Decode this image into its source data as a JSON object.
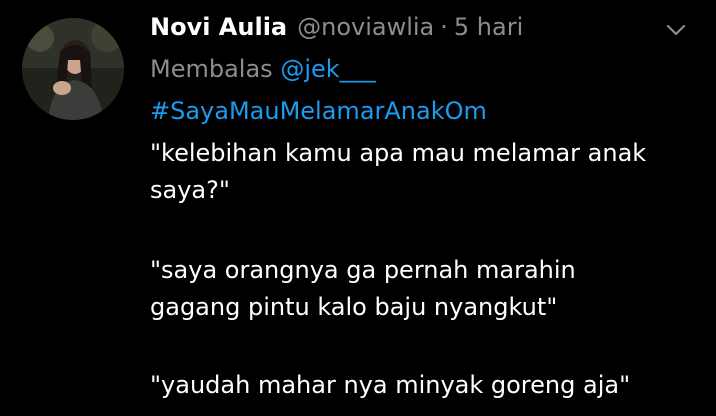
{
  "tweet": {
    "display_name": "Novi Aulia",
    "handle": "@noviawlia",
    "separator": "·",
    "time": "5 hari",
    "reply_label": "Membalas",
    "reply_to": "@jek___",
    "hashtag": "#SayaMauMelamarAnakOm",
    "lines": [
      "\"kelebihan kamu apa mau melamar anak",
      "saya?\"",
      "\"saya orangnya ga pernah marahin",
      "gagang pintu kalo baju nyangkut\"",
      "\"yaudah mahar nya minyak goreng aja\""
    ]
  },
  "colors": {
    "background": "#000000",
    "name": "#ffffff",
    "secondary": "#8a8d91",
    "link": "#1d9bf0"
  },
  "icons": {
    "avatar": "avatar-photo",
    "menu": "chevron-down-icon"
  }
}
